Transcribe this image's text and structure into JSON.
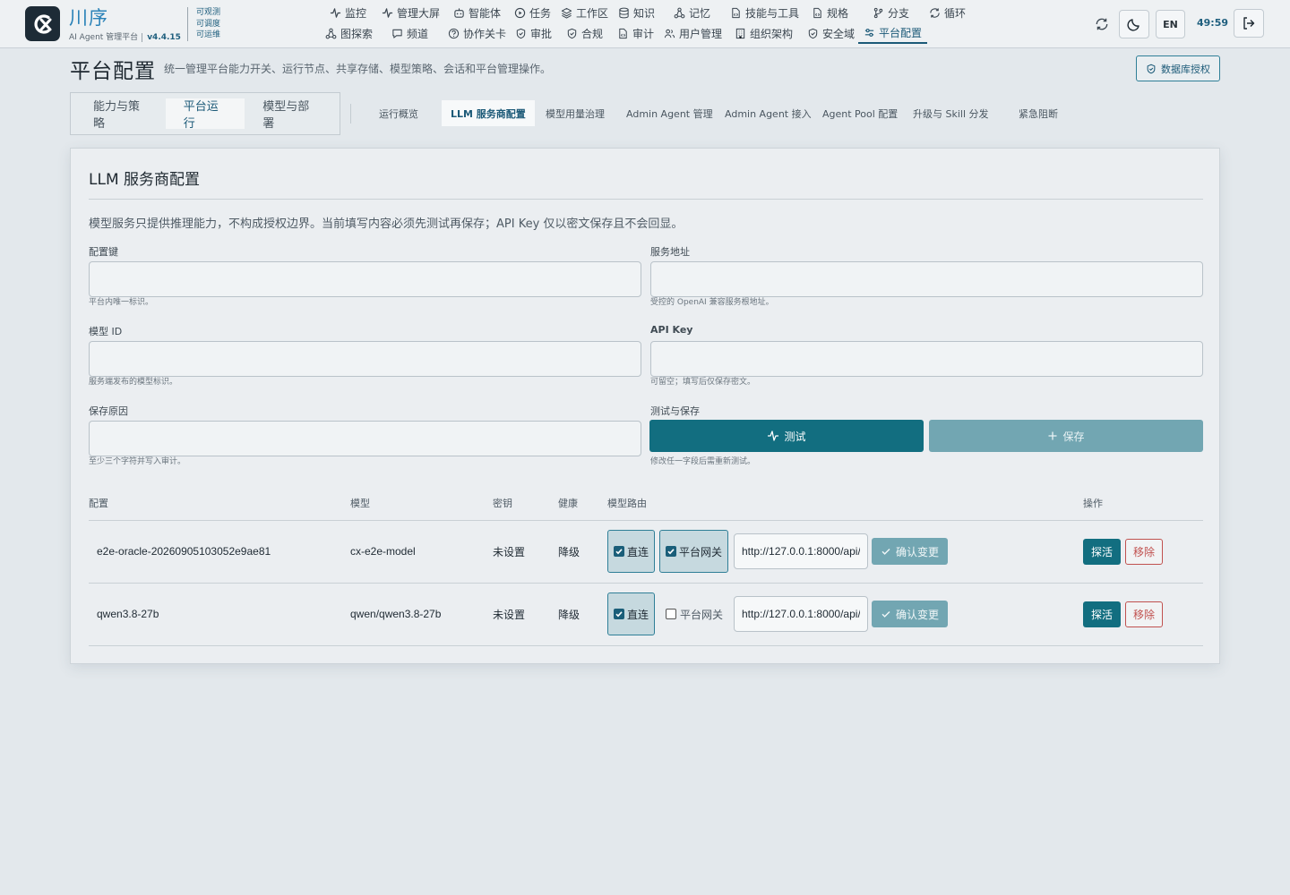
{
  "brand": {
    "name": "川序",
    "subtitle": "AI Agent 管理平台",
    "version": "v4.4.15",
    "taglines": [
      "可观测",
      "可调度",
      "可运维"
    ]
  },
  "nav": {
    "row1": [
      {
        "label": "监控",
        "icon": "activity-icon"
      },
      {
        "label": "管理大屏",
        "icon": "activity-icon"
      },
      {
        "label": "智能体",
        "icon": "bot-icon"
      },
      {
        "label": "任务",
        "icon": "play-circle-icon"
      },
      {
        "label": "工作区",
        "icon": "layers-icon"
      },
      {
        "label": "知识",
        "icon": "database-icon"
      },
      {
        "label": "记忆",
        "icon": "network-icon"
      },
      {
        "label": "技能与工具",
        "icon": "file-code-icon"
      },
      {
        "label": "规格",
        "icon": "file-code-icon"
      },
      {
        "label": "分支",
        "icon": "git-branch-icon"
      },
      {
        "label": "循环",
        "icon": "refresh-icon"
      }
    ],
    "row2": [
      {
        "label": "图探索",
        "icon": "network-icon"
      },
      {
        "label": "频道",
        "icon": "message-icon"
      },
      {
        "label": "协作关卡",
        "icon": "help-circle-icon"
      },
      {
        "label": "审批",
        "icon": "shield-check-icon"
      },
      {
        "label": "合规",
        "icon": "shield-check-icon"
      },
      {
        "label": "审计",
        "icon": "file-code-icon"
      },
      {
        "label": "用户管理",
        "icon": "users-icon"
      },
      {
        "label": "组织架构",
        "icon": "building-icon"
      },
      {
        "label": "安全域",
        "icon": "shield-check-icon"
      },
      {
        "label": "平台配置",
        "icon": "sliders-icon",
        "active": true
      }
    ]
  },
  "header_actions": {
    "lang": "EN",
    "timer": "49:59"
  },
  "page": {
    "title": "平台配置",
    "description": "统一管理平台能力开关、运行节点、共享存储、模型策略、会话和平台管理操作。",
    "db_auth_label": "数据库授权"
  },
  "primary_tabs": [
    "能力与策略",
    "平台运行",
    "模型与部署"
  ],
  "primary_active": "平台运行",
  "secondary_tabs": [
    "运行概览",
    "LLM 服务商配置",
    "模型用量治理",
    "Admin Agent 管理",
    "Admin Agent 接入",
    "Agent Pool 配置",
    "升级与 Skill 分发",
    "紧急阻断"
  ],
  "secondary_active": "LLM 服务商配置",
  "card": {
    "title": "LLM 服务商配置",
    "note": "模型服务只提供推理能力，不构成授权边界。当前填写内容必须先测试再保存；API Key 仅以密文保存且不会回显。",
    "fields": {
      "config_key": {
        "label": "配置键",
        "value": "",
        "hint": "平台内唯一标识。"
      },
      "service_url": {
        "label": "服务地址",
        "value": "",
        "hint": "受控的 OpenAI 兼容服务根地址。"
      },
      "model_id": {
        "label": "模型 ID",
        "value": "",
        "hint": "服务端发布的模型标识。"
      },
      "api_key": {
        "label": "API Key",
        "value": "",
        "hint": "可留空；填写后仅保存密文。"
      },
      "save_reason": {
        "label": "保存原因",
        "value": "",
        "hint": "至少三个字符并写入审计。"
      },
      "test_save": {
        "label": "测试与保存",
        "hint": "修改任一字段后需重新测试。"
      }
    },
    "test_label": "测试",
    "save_label": "保存"
  },
  "table": {
    "headers": {
      "config": "配置",
      "model": "模型",
      "key": "密钥",
      "health": "健康",
      "route": "模型路由",
      "actions": "操作"
    },
    "rows": [
      {
        "config": "e2e-oracle-20260905103052e9ae81",
        "model": "cx-e2e-model",
        "key": "未设置",
        "health": "降级",
        "direct": {
          "label": "直连",
          "checked": true
        },
        "gateway": {
          "label": "平台网关",
          "checked": true
        },
        "url": "http://127.0.0.1:8000/api/",
        "confirm": "确认变更",
        "probe": "探活",
        "remove": "移除"
      },
      {
        "config": "qwen3.8-27b",
        "model": "qwen/qwen3.8-27b",
        "key": "未设置",
        "health": "降级",
        "direct": {
          "label": "直连",
          "checked": true
        },
        "gateway": {
          "label": "平台网关",
          "checked": false
        },
        "url": "http://127.0.0.1:8000/api/",
        "confirm": "确认变更",
        "probe": "探活",
        "remove": "移除"
      }
    ]
  },
  "colors": {
    "accent": "#126e80",
    "brand": "#2a82b8",
    "danger": "#c0514f",
    "page_bg": "#e3e8ec"
  }
}
